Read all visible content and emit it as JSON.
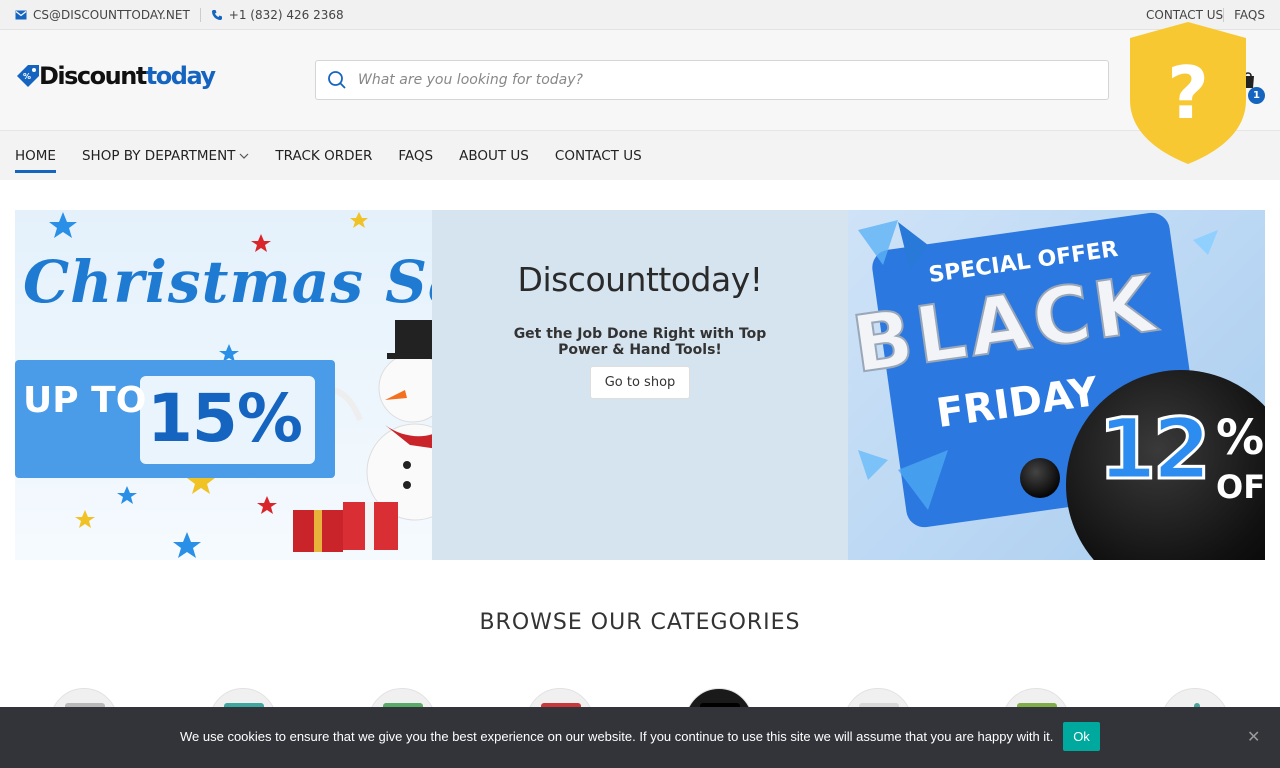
{
  "topbar": {
    "email_icon": "envelope-icon",
    "email": "CS@DISCOUNTTODAY.NET",
    "phone_icon": "phone-icon",
    "phone": "+1 (832) 426 2368",
    "contact_link": "CONTACT US",
    "faqs_link": "FAQS"
  },
  "header": {
    "logo_dark": "Discount",
    "logo_blue": "today",
    "search_placeholder": "What are you looking for today?",
    "cart_count": "1"
  },
  "nav": {
    "items": [
      "HOME",
      "SHOP BY DEPARTMENT",
      "TRACK ORDER",
      "FAQS",
      "ABOUT US",
      "CONTACT US"
    ]
  },
  "shield": {
    "glyph": "?",
    "color": "#f8c832"
  },
  "banners": {
    "xmas_title": "Christmas Sale",
    "upto": "UP TO",
    "percent": "15%",
    "center_title": "Discounttoday!",
    "center_sub": "Get the Job Done Right with Top Power & Hand Tools!",
    "center_button": "Go to shop",
    "special": "SPECIAL OFFER",
    "black": "BLACK",
    "friday": "FRIDAY",
    "twelve": "12",
    "pct_sign": "%",
    "off": "OFF"
  },
  "categories": {
    "title": "BROWSE OUR CATEGORIES"
  },
  "cookie": {
    "text": "We use cookies to ensure that we give you the best experience on our website. If you continue to use this site we will assume that you are happy with it.",
    "ok": "Ok",
    "close": "✕"
  },
  "colors": {
    "accent": "#1565c0",
    "cookie_bg": "#32343a",
    "ok_button": "#00a99d"
  }
}
